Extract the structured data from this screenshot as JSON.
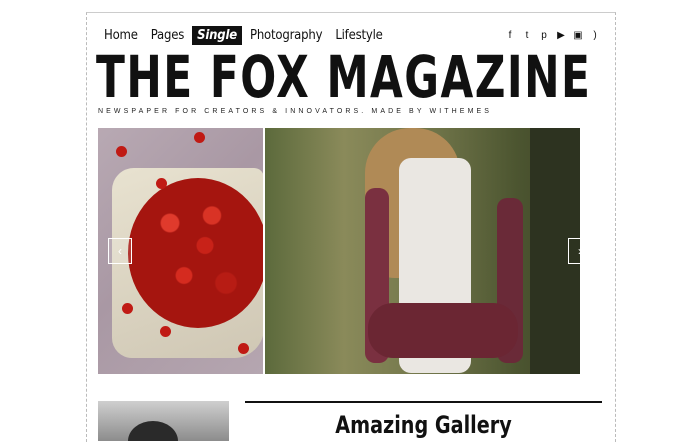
{
  "nav": {
    "items": [
      {
        "label": "Home"
      },
      {
        "label": "Pages"
      },
      {
        "label": "Single",
        "active": true
      },
      {
        "label": "Photography"
      },
      {
        "label": "Lifestyle"
      }
    ]
  },
  "social": {
    "icons": [
      "facebook-icon",
      "twitter-icon",
      "pinterest-icon",
      "youtube-icon",
      "instagram-icon",
      "rss-icon"
    ],
    "glyphs": [
      "f",
      "t",
      "p",
      "▶",
      "▣",
      ")"
    ]
  },
  "site": {
    "title": "THE FOX MAGAZINE",
    "tagline": "NEWSPAPER FOR CREATORS & INNOVATORS. MADE BY WITHEMES"
  },
  "slider": {
    "prev": "‹",
    "next": "›",
    "slides": [
      "cherries-photo",
      "woman-forest-photo"
    ]
  },
  "post": {
    "title": "Amazing Gallery"
  },
  "colors": {
    "text": "#111111",
    "active_bg": "#111111",
    "background": "#ffffff"
  }
}
